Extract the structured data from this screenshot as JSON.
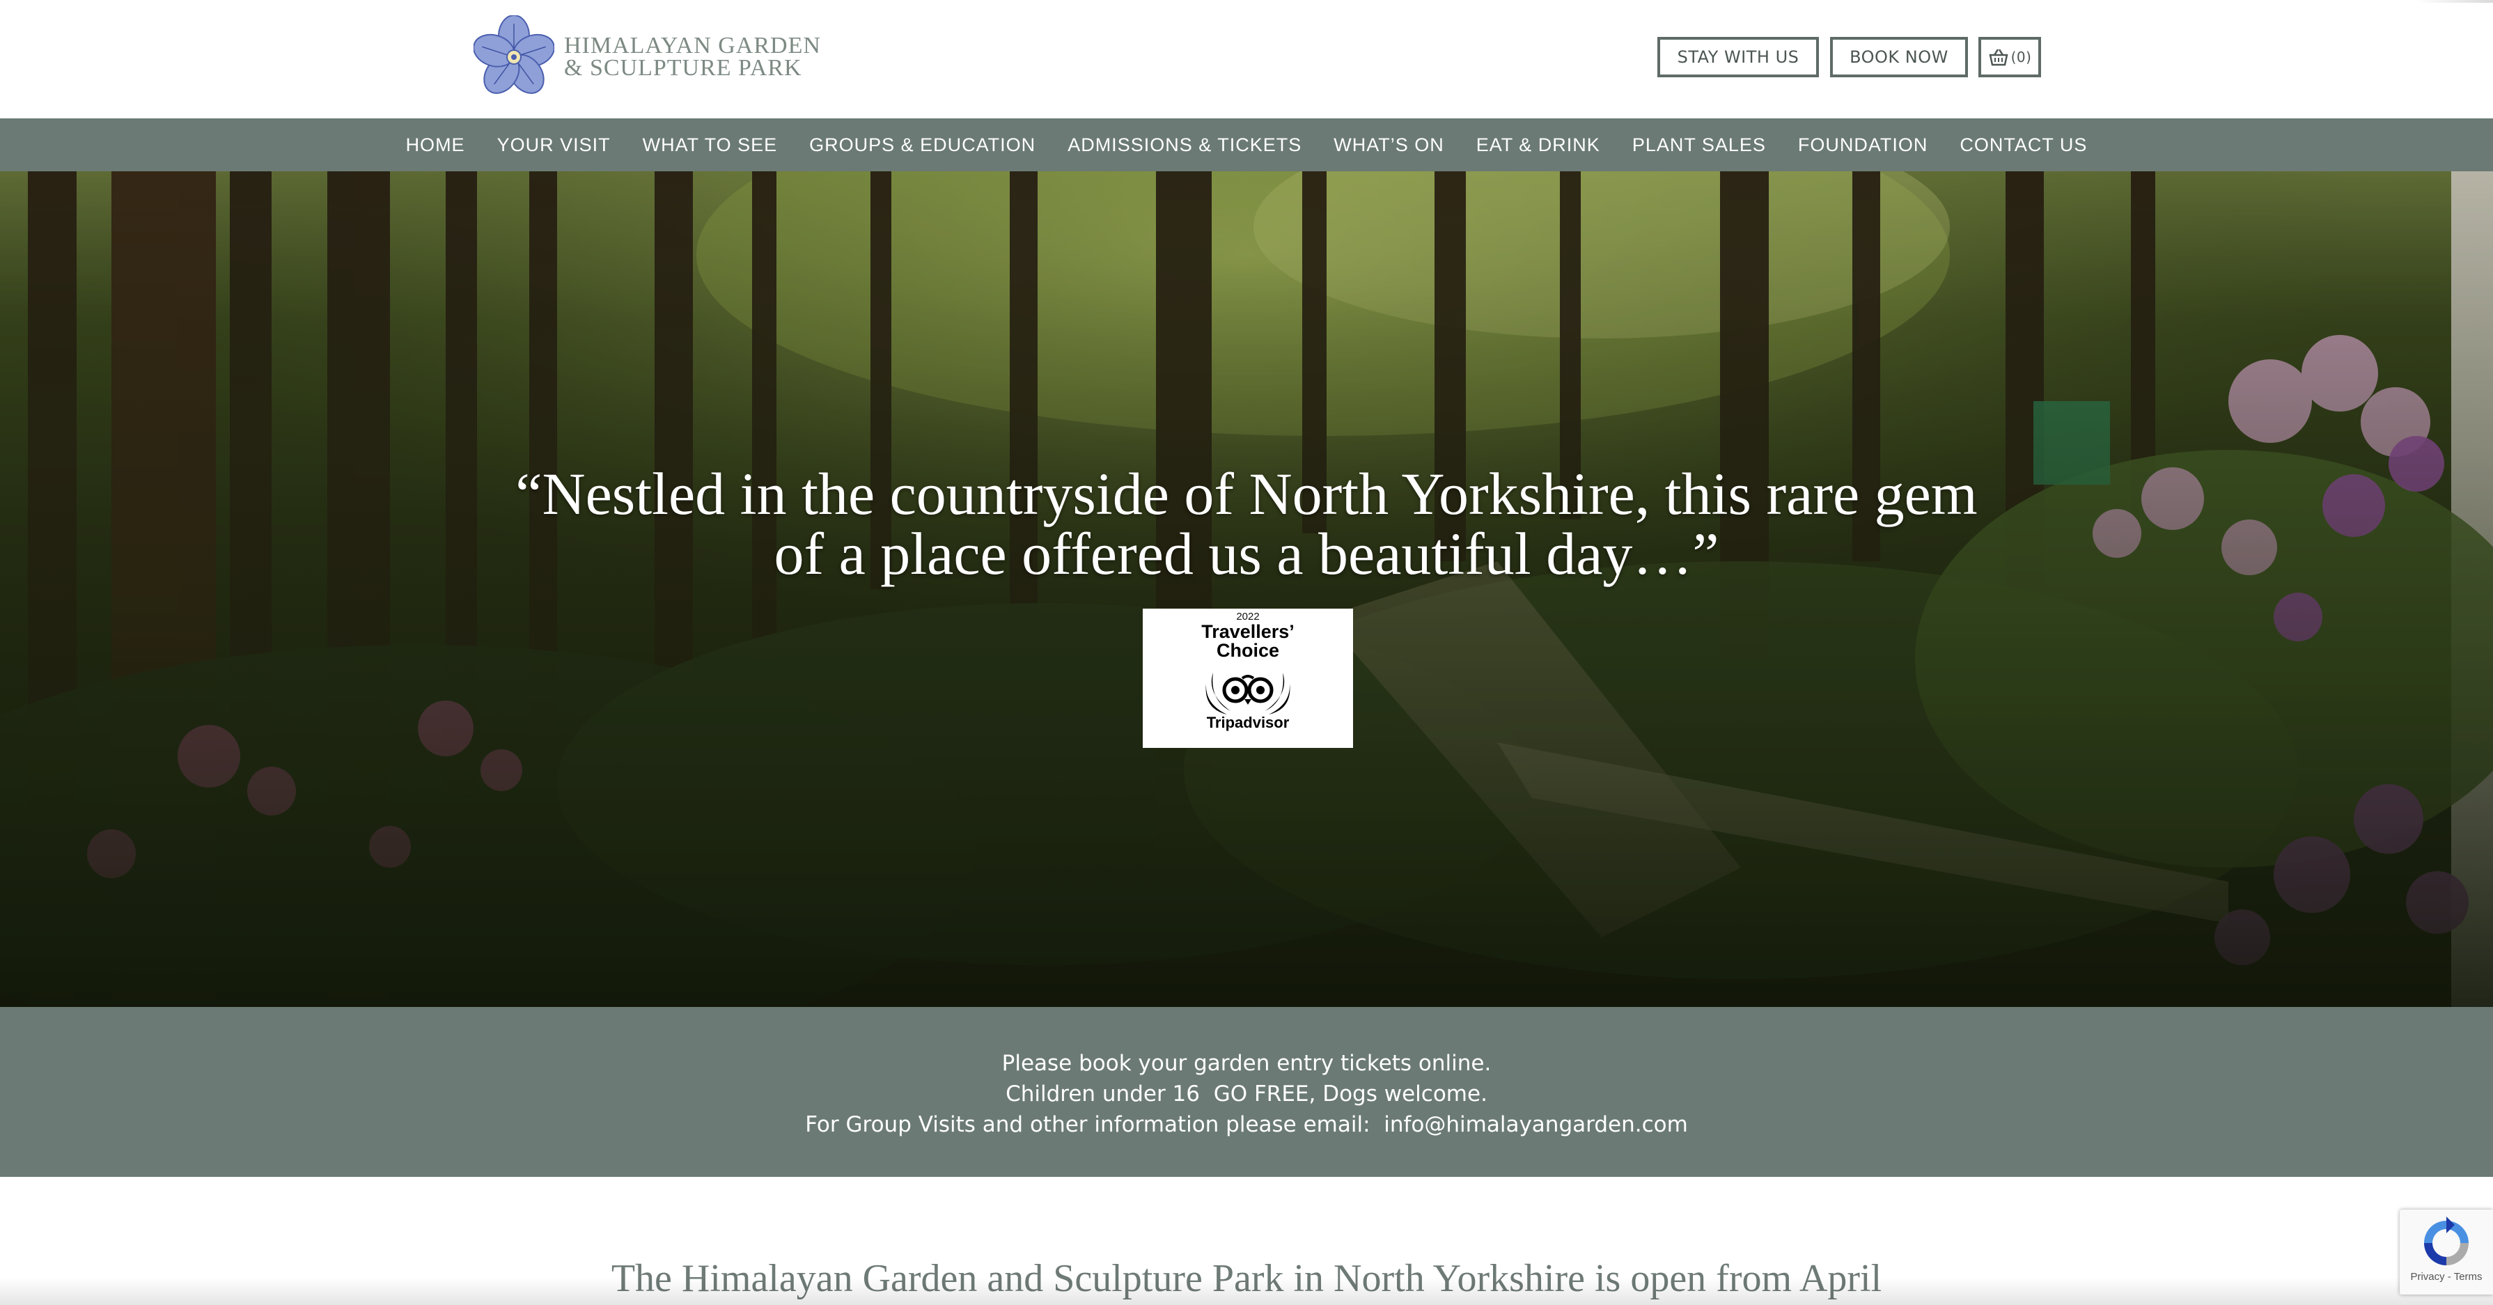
{
  "header": {
    "logo_line1": "HIMALAYAN GARDEN",
    "logo_line2": "& SCULPTURE PARK",
    "stay_label": "STAY WITH US",
    "book_label": "BOOK NOW",
    "cart_count": "(0)"
  },
  "nav": {
    "items": [
      {
        "label": "HOME"
      },
      {
        "label": "YOUR VISIT"
      },
      {
        "label": "WHAT TO SEE"
      },
      {
        "label": "GROUPS & EDUCATION"
      },
      {
        "label": "ADMISSIONS & TICKETS"
      },
      {
        "label": "WHAT’S ON"
      },
      {
        "label": "EAT & DRINK"
      },
      {
        "label": "PLANT SALES"
      },
      {
        "label": "FOUNDATION"
      },
      {
        "label": "CONTACT US"
      }
    ]
  },
  "hero": {
    "quote_line1": "“Nestled in the countryside of North Yorkshire, this rare gem",
    "quote_line2": "of a place offered us a beautiful day…”",
    "badge": {
      "year": "2022",
      "title_line1": "Travellers’",
      "title_line2": "Choice",
      "brand": "Tripadvisor"
    }
  },
  "info": {
    "line1": "Please book your garden entry tickets online.",
    "line2": "Children under 16  GO FREE, Dogs welcome.",
    "line3": "For Group Visits and other information please email:  info@himalayangarden.com"
  },
  "intro": {
    "heading": "The Himalayan Garden and Sculpture Park in North Yorkshire is open from April"
  },
  "recaptcha": {
    "privacy": "Privacy",
    "terms": "Terms"
  },
  "colors": {
    "nav_bg": "#6b7a74",
    "logo_flower": "#5b6fb8",
    "logo_text": "#7d8a83",
    "button_border": "#5e6b66"
  }
}
